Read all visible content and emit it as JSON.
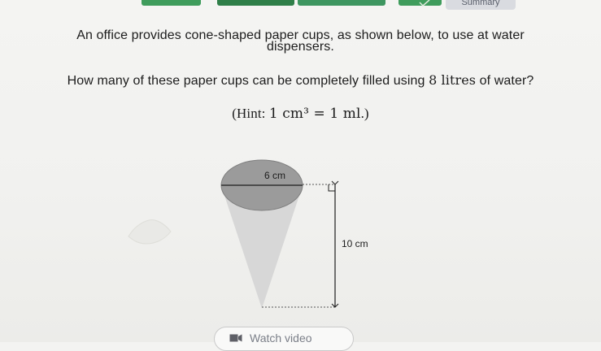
{
  "header": {
    "summary_label": "Summary"
  },
  "question": {
    "line1": "An office provides cone-shaped paper cups, as shown below, to use at water",
    "line2": "dispensers.",
    "line3_prefix": "How many of these paper cups can be completely filled using ",
    "line3_math": "8 litres",
    "line3_suffix": " of water?",
    "hint_prefix": "(Hint: ",
    "hint_math": "1 cm³ = 1 ml",
    "hint_suffix": ".)"
  },
  "diagram": {
    "top_label": "6 cm",
    "height_label": "10 cm"
  },
  "actions": {
    "watch_video_label": "Watch video"
  },
  "colors": {
    "cone_top": "#9a9a9a",
    "cone_body": "#d8d8d8",
    "top_green": "#3c8f56",
    "summary_tab": "#d9dbe0"
  },
  "icons": {
    "check": "check-icon",
    "video": "video-icon"
  }
}
